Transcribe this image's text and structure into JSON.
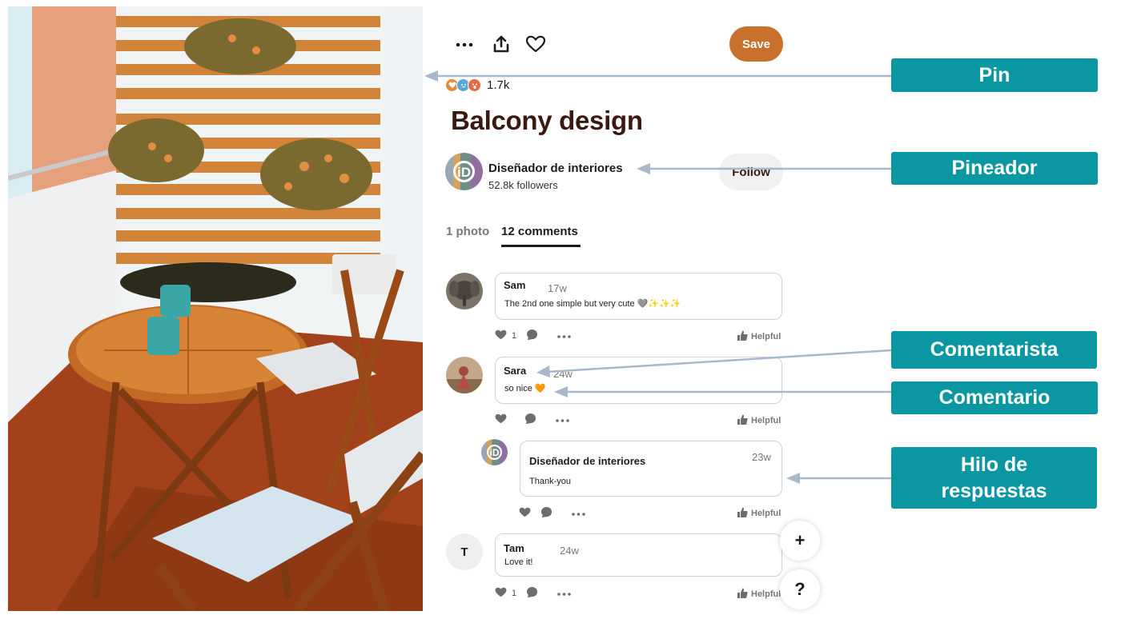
{
  "pin": {
    "title": "Balcony design",
    "reaction_count": "1.7k",
    "save_label": "Save"
  },
  "pinner": {
    "name": "Diseñador de interiores",
    "followers": "52.8k followers",
    "follow_label": "Follow"
  },
  "tabs": [
    {
      "label": "1 photo",
      "active": false
    },
    {
      "label": "12 comments",
      "active": true
    }
  ],
  "comments": [
    {
      "author": "Sam",
      "time": "17w",
      "text": "The 2nd one simple but very cute 🩶✨✨✨",
      "likes": "1",
      "helpful": "Helpful"
    },
    {
      "author": "Sara",
      "time": "24w",
      "text": "so nice 🧡",
      "likes": "",
      "helpful": "Helpful"
    },
    {
      "author": "Diseñador de interiores",
      "time": "23w",
      "text": "Thank-you",
      "likes": "",
      "helpful": "Helpful"
    },
    {
      "author": "Tam",
      "time": "24w",
      "text": "Love it!",
      "likes": "1",
      "helpful": "Helpful",
      "avatar_letter": "T"
    }
  ],
  "fab": {
    "plus": "+",
    "help": "?"
  },
  "annotations": {
    "pin": "Pin",
    "pinner": "Pineador",
    "commenter": "Comentarista",
    "comment": "Comentario",
    "reply_thread_line1": "Hilo de",
    "reply_thread_line2": "respuestas"
  },
  "colors": {
    "save_button": "#c8702c",
    "annotation": "#0b97a1",
    "arrow": "#a8b7c9"
  }
}
